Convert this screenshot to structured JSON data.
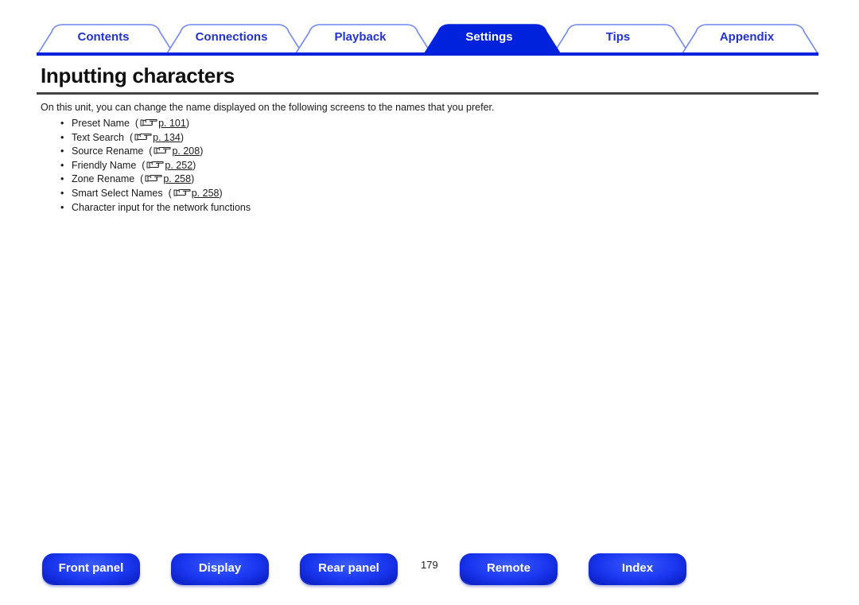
{
  "tabs": [
    {
      "label": "Contents",
      "active": false
    },
    {
      "label": "Connections",
      "active": false
    },
    {
      "label": "Playback",
      "active": false
    },
    {
      "label": "Settings",
      "active": true
    },
    {
      "label": "Tips",
      "active": false
    },
    {
      "label": "Appendix",
      "active": false
    }
  ],
  "colors": {
    "accent": "#0022dd",
    "tab_outline": "#6f86f2",
    "tab_text": "#2233cc",
    "rule": "#444444"
  },
  "page": {
    "title": "Inputting characters",
    "intro": "On this unit, you can change the name displayed on the following screens to the names that you prefer.",
    "items": [
      {
        "label": "Preset Name",
        "ref": "p. 101",
        "icon": "pointing-hand-icon"
      },
      {
        "label": "Text Search",
        "ref": "p. 134",
        "icon": "pointing-hand-icon"
      },
      {
        "label": "Source Rename",
        "ref": "p. 208",
        "icon": "pointing-hand-icon"
      },
      {
        "label": "Friendly Name",
        "ref": "p. 252",
        "icon": "pointing-hand-icon"
      },
      {
        "label": "Zone Rename",
        "ref": "p. 258",
        "icon": "pointing-hand-icon"
      },
      {
        "label": "Smart Select Names",
        "ref": "p. 258",
        "icon": "pointing-hand-icon"
      },
      {
        "label": "Character input for the network functions",
        "ref": null
      }
    ]
  },
  "footer": {
    "buttons": [
      "Front panel",
      "Display",
      "Rear panel",
      "Remote",
      "Index"
    ],
    "page_number": "179"
  }
}
